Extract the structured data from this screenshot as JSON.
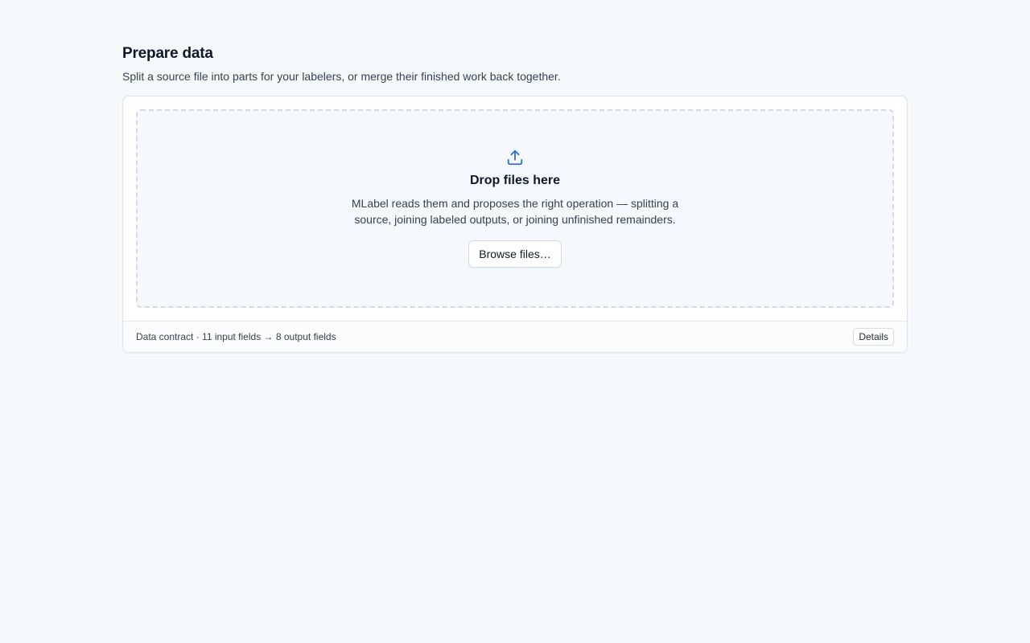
{
  "header": {
    "title": "Prepare data",
    "subtitle": "Split a source file into parts for your labelers, or merge their finished work back together."
  },
  "dropzone": {
    "icon": "upload-icon",
    "title": "Drop files here",
    "description": "MLabel reads them and proposes the right operation — splitting a source, joining labeled outputs, or joining unfinished remainders.",
    "browse_label": "Browse files…"
  },
  "footer": {
    "contract_text": "Data contract · 11 input fields → 8 output fields",
    "details_label": "Details"
  },
  "colors": {
    "background": "#f6f9fc",
    "accent": "#2f6fd6",
    "dropzone_background": "#f5f8fc",
    "dropzone_border": "#d3dae2"
  }
}
